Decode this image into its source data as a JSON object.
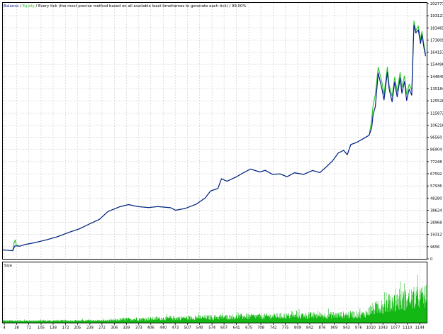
{
  "header": {
    "balance_label": "Balance",
    "sep1": " / ",
    "equity_label": "Equity",
    "rest": " / Every tick (the most precise method based on all available least timeframes to generate each tick) / 99.00%"
  },
  "colors": {
    "balance": "#0a1f8f",
    "equity": "#25c425",
    "volume": "#14b814",
    "grid": "#c8c8c8",
    "axis": "#000000",
    "text": "#000000"
  },
  "chart_data": [
    {
      "type": "line",
      "title": "",
      "series": [
        {
          "name": "Balance",
          "points": [
            [
              0,
              7100
            ],
            [
              10,
              6900
            ],
            [
              20,
              6600
            ],
            [
              27,
              6400
            ],
            [
              33,
              10300
            ],
            [
              46,
              10000
            ],
            [
              60,
              11300
            ],
            [
              80,
              12400
            ],
            [
              100,
              13700
            ],
            [
              120,
              15100
            ],
            [
              150,
              17600
            ],
            [
              180,
              20900
            ],
            [
              210,
              23800
            ],
            [
              235,
              27300
            ],
            [
              265,
              31400
            ],
            [
              288,
              37500
            ],
            [
              320,
              41300
            ],
            [
              345,
              43100
            ],
            [
              370,
              41500
            ],
            [
              400,
              40700
            ],
            [
              425,
              41500
            ],
            [
              460,
              40600
            ],
            [
              474,
              38600
            ],
            [
              500,
              40000
            ],
            [
              530,
              43300
            ],
            [
              555,
              48300
            ],
            [
              570,
              53900
            ],
            [
              590,
              55900
            ],
            [
              600,
              63600
            ],
            [
              615,
              61600
            ],
            [
              640,
              65000
            ],
            [
              660,
              68400
            ],
            [
              680,
              71300
            ],
            [
              705,
              69000
            ],
            [
              720,
              70300
            ],
            [
              740,
              67100
            ],
            [
              760,
              67500
            ],
            [
              780,
              65200
            ],
            [
              800,
              68400
            ],
            [
              825,
              67100
            ],
            [
              850,
              70200
            ],
            [
              870,
              68500
            ],
            [
              890,
              73700
            ],
            [
              905,
              77900
            ],
            [
              920,
              84000
            ],
            [
              935,
              86200
            ],
            [
              945,
              82700
            ],
            [
              955,
              90800
            ],
            [
              970,
              92400
            ],
            [
              990,
              95600
            ],
            [
              1005,
              98200
            ],
            [
              1012,
              104100
            ],
            [
              1016,
              114600
            ],
            [
              1022,
              120800
            ],
            [
              1030,
              147600
            ],
            [
              1040,
              135200
            ],
            [
              1046,
              126300
            ],
            [
              1055,
              148200
            ],
            [
              1060,
              134900
            ],
            [
              1068,
              124700
            ],
            [
              1075,
              140300
            ],
            [
              1082,
              128600
            ],
            [
              1090,
              143700
            ],
            [
              1095,
              131500
            ],
            [
              1102,
              140900
            ],
            [
              1108,
              125800
            ],
            [
              1115,
              134800
            ],
            [
              1122,
              130000
            ],
            [
              1128,
              185700
            ],
            [
              1133,
              179500
            ],
            [
              1140,
              181900
            ],
            [
              1146,
              171000
            ],
            [
              1150,
              177900
            ],
            [
              1156,
              166800
            ],
            [
              1160,
              160900
            ]
          ]
        },
        {
          "name": "Equity",
          "points": [
            [
              0,
              7100
            ],
            [
              10,
              6900
            ],
            [
              20,
              6600
            ],
            [
              27,
              6400
            ],
            [
              31,
              12800
            ],
            [
              34,
              15000
            ],
            [
              37,
              11000
            ],
            [
              46,
              10100
            ],
            [
              60,
              11300
            ],
            [
              80,
              12400
            ],
            [
              100,
              13700
            ],
            [
              120,
              15100
            ],
            [
              150,
              17600
            ],
            [
              180,
              20900
            ],
            [
              210,
              23800
            ],
            [
              235,
              27300
            ],
            [
              265,
              31400
            ],
            [
              288,
              37500
            ],
            [
              320,
              41300
            ],
            [
              345,
              43100
            ],
            [
              370,
              41500
            ],
            [
              400,
              40700
            ],
            [
              425,
              41500
            ],
            [
              460,
              40600
            ],
            [
              474,
              38600
            ],
            [
              500,
              40000
            ],
            [
              530,
              43300
            ],
            [
              555,
              48300
            ],
            [
              570,
              53900
            ],
            [
              590,
              55900
            ],
            [
              600,
              63600
            ],
            [
              615,
              61600
            ],
            [
              640,
              65000
            ],
            [
              660,
              68400
            ],
            [
              680,
              71300
            ],
            [
              705,
              69000
            ],
            [
              720,
              70300
            ],
            [
              740,
              67100
            ],
            [
              760,
              67500
            ],
            [
              780,
              65200
            ],
            [
              800,
              68400
            ],
            [
              825,
              67100
            ],
            [
              850,
              70200
            ],
            [
              870,
              68500
            ],
            [
              890,
              73700
            ],
            [
              905,
              77900
            ],
            [
              920,
              84000
            ],
            [
              935,
              86200
            ],
            [
              945,
              82700
            ],
            [
              955,
              90800
            ],
            [
              970,
              92400
            ],
            [
              990,
              95600
            ],
            [
              1005,
              98200
            ],
            [
              1012,
              110500
            ],
            [
              1016,
              122000
            ],
            [
              1022,
              130500
            ],
            [
              1030,
              152200
            ],
            [
              1040,
              140500
            ],
            [
              1046,
              130800
            ],
            [
              1055,
              152300
            ],
            [
              1060,
              138200
            ],
            [
              1068,
              129000
            ],
            [
              1075,
              144200
            ],
            [
              1082,
              133000
            ],
            [
              1090,
              148000
            ],
            [
              1095,
              136200
            ],
            [
              1102,
              145200
            ],
            [
              1108,
              130600
            ],
            [
              1115,
              138700
            ],
            [
              1122,
              134000
            ],
            [
              1128,
              188900
            ],
            [
              1133,
              181200
            ],
            [
              1140,
              184900
            ],
            [
              1146,
              173800
            ],
            [
              1150,
              180500
            ],
            [
              1156,
              168900
            ],
            [
              1160,
              162700
            ]
          ]
        }
      ],
      "ylim": [
        0,
        202777
      ],
      "y_ticks": [
        "202777",
        "193121",
        "183465",
        "173809",
        "164153",
        "154496",
        "144840",
        "135184",
        "125528",
        "115872",
        "106216",
        "96560",
        "86904",
        "77248",
        "67592",
        "57936",
        "48280",
        "38624",
        "28968",
        "19312",
        "9656",
        "0"
      ],
      "grid": true
    },
    {
      "type": "bar",
      "title": "Size",
      "series": [
        {
          "name": "Size",
          "envelope": [
            [
              0,
              0.05
            ],
            [
              100,
              0.05
            ],
            [
              300,
              0.06
            ],
            [
              330,
              0.09
            ],
            [
              500,
              0.13
            ],
            [
              700,
              0.17
            ],
            [
              900,
              0.2
            ],
            [
              990,
              0.22
            ],
            [
              1000,
              0.27
            ],
            [
              1010,
              0.35
            ],
            [
              1070,
              0.55
            ],
            [
              1120,
              0.65
            ],
            [
              1163,
              0.7
            ]
          ]
        }
      ],
      "ylim": [
        0,
        1
      ],
      "grid": true
    }
  ],
  "x_axis": {
    "ticks": [
      "4",
      "38",
      "71",
      "105",
      "138",
      "172",
      "205",
      "239",
      "272",
      "306",
      "339",
      "373",
      "406",
      "440",
      "473",
      "507",
      "540",
      "574",
      "607",
      "641",
      "675",
      "708",
      "742",
      "775",
      "809",
      "842",
      "876",
      "909",
      "943",
      "976",
      "1010",
      "1043",
      "1077",
      "1110",
      "1144"
    ]
  }
}
